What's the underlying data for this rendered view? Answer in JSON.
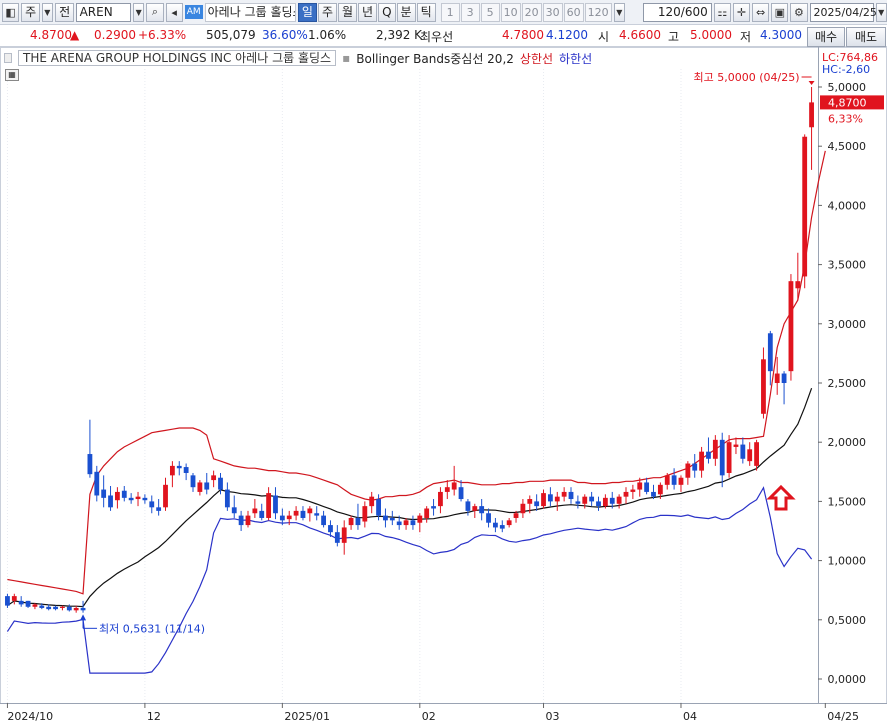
{
  "toolbar": {
    "market": "주",
    "all": "전",
    "symbol": "AREN",
    "am_badge": "AM",
    "name": "아레나 그룹 홀딩스",
    "periods": [
      "일",
      "주",
      "월",
      "년",
      "Q",
      "분",
      "틱"
    ],
    "selected_period": "일",
    "intervals": [
      "1",
      "3",
      "5",
      "10",
      "20",
      "30",
      "60",
      "120"
    ],
    "count": "120",
    "total": "/600",
    "date": "2025/04/25"
  },
  "quote": {
    "price": "4.8700",
    "change": "0.2900",
    "change_pct": "+6.33%",
    "volume": "505,079",
    "turnover_pct": "36.60%",
    "vol_ratio": "1.06%",
    "amount": "2,392 K",
    "best_ask_label": "최우선",
    "best_ask": "4.7800",
    "best_bid": "4.1200",
    "open_label": "시",
    "open": "4.6600",
    "high_label": "고",
    "high": "5.0000",
    "low_label": "저",
    "low": "4.3000",
    "buy_label": "매수",
    "sell_label": "매도"
  },
  "legend": {
    "company": "THE ARENA GROUP HOLDINGS INC  아레나 그룹 홀딩스",
    "indicator": "Bollinger Bands중심선 20,2",
    "upper": "상한선",
    "lower": "하한선"
  },
  "colors": {
    "up": "#e0141e",
    "down": "#1a50d0",
    "upper_band": "#d0161e",
    "lower_band": "#2a32c8",
    "middle_band": "#111111",
    "last_price_bg": "#e0141e"
  },
  "chart_data": {
    "type": "candlestick",
    "y_ticks": [
      "5,0000",
      "4,5000",
      "4,0000",
      "3,5000",
      "3,0000",
      "2,5000",
      "2,0000",
      "1,5000",
      "1,0000",
      "0,5000",
      "0,0000"
    ],
    "ylim": [
      0,
      5.0
    ],
    "x_ticks": [
      {
        "label": "2024/10",
        "idx": 0
      },
      {
        "label": "12",
        "idx": 20
      },
      {
        "label": "2025/01",
        "idx": 40
      },
      {
        "label": "02",
        "idx": 60
      },
      {
        "label": "03",
        "idx": 78
      },
      {
        "label": "04",
        "idx": 98
      },
      {
        "label": "04/25",
        "idx": 119
      }
    ],
    "lc": "LC:764,86",
    "hc": "HC:-2,60",
    "last_price": "4,8700",
    "last_pct": "6,33%",
    "high_note": "최고 5,0000 (04/25)",
    "low_note": "최저 0,5631 (11/14)",
    "candles": [
      [
        0.7,
        0.72,
        0.6,
        0.62
      ],
      [
        0.66,
        0.72,
        0.63,
        0.7
      ],
      [
        0.66,
        0.7,
        0.61,
        0.63
      ],
      [
        0.66,
        0.66,
        0.6,
        0.61
      ],
      [
        0.61,
        0.64,
        0.59,
        0.63
      ],
      [
        0.62,
        0.64,
        0.59,
        0.6
      ],
      [
        0.61,
        0.63,
        0.58,
        0.59
      ],
      [
        0.61,
        0.62,
        0.58,
        0.59
      ],
      [
        0.6,
        0.62,
        0.58,
        0.61
      ],
      [
        0.61,
        0.63,
        0.57,
        0.58
      ],
      [
        0.58,
        0.62,
        0.56,
        0.6
      ],
      [
        0.6,
        0.66,
        0.56,
        0.58
      ],
      [
        1.9,
        2.19,
        1.7,
        1.73
      ],
      [
        1.75,
        1.8,
        1.5,
        1.55
      ],
      [
        1.6,
        1.72,
        1.45,
        1.53
      ],
      [
        1.55,
        1.63,
        1.42,
        1.45
      ],
      [
        1.51,
        1.62,
        1.44,
        1.58
      ],
      [
        1.59,
        1.63,
        1.5,
        1.53
      ],
      [
        1.53,
        1.57,
        1.48,
        1.51
      ],
      [
        1.52,
        1.58,
        1.46,
        1.54
      ],
      [
        1.53,
        1.56,
        1.48,
        1.51
      ],
      [
        1.5,
        1.55,
        1.4,
        1.45
      ],
      [
        1.45,
        1.52,
        1.38,
        1.42
      ],
      [
        1.45,
        1.7,
        1.42,
        1.64
      ],
      [
        1.72,
        1.84,
        1.62,
        1.8
      ],
      [
        1.8,
        1.84,
        1.72,
        1.78
      ],
      [
        1.79,
        1.82,
        1.68,
        1.74
      ],
      [
        1.72,
        1.74,
        1.58,
        1.62
      ],
      [
        1.58,
        1.68,
        1.55,
        1.66
      ],
      [
        1.66,
        1.74,
        1.56,
        1.6
      ],
      [
        1.68,
        1.76,
        1.62,
        1.72
      ],
      [
        1.7,
        1.74,
        1.56,
        1.6
      ],
      [
        1.6,
        1.66,
        1.42,
        1.45
      ],
      [
        1.45,
        1.55,
        1.36,
        1.4
      ],
      [
        1.38,
        1.42,
        1.25,
        1.3
      ],
      [
        1.3,
        1.42,
        1.28,
        1.38
      ],
      [
        1.4,
        1.52,
        1.36,
        1.44
      ],
      [
        1.42,
        1.48,
        1.34,
        1.36
      ],
      [
        1.36,
        1.62,
        1.34,
        1.57
      ],
      [
        1.55,
        1.62,
        1.35,
        1.4
      ],
      [
        1.38,
        1.44,
        1.3,
        1.34
      ],
      [
        1.35,
        1.42,
        1.3,
        1.38
      ],
      [
        1.38,
        1.46,
        1.34,
        1.42
      ],
      [
        1.42,
        1.46,
        1.34,
        1.36
      ],
      [
        1.4,
        1.46,
        1.33,
        1.44
      ],
      [
        1.4,
        1.46,
        1.34,
        1.38
      ],
      [
        1.38,
        1.42,
        1.28,
        1.3
      ],
      [
        1.3,
        1.34,
        1.2,
        1.24
      ],
      [
        1.24,
        1.3,
        1.12,
        1.15
      ],
      [
        1.15,
        1.34,
        1.05,
        1.28
      ],
      [
        1.3,
        1.38,
        1.26,
        1.36
      ],
      [
        1.36,
        1.48,
        1.26,
        1.3
      ],
      [
        1.33,
        1.5,
        1.28,
        1.46
      ],
      [
        1.46,
        1.58,
        1.4,
        1.54
      ],
      [
        1.52,
        1.56,
        1.34,
        1.38
      ],
      [
        1.38,
        1.44,
        1.28,
        1.34
      ],
      [
        1.36,
        1.42,
        1.3,
        1.34
      ],
      [
        1.33,
        1.38,
        1.26,
        1.3
      ],
      [
        1.3,
        1.36,
        1.26,
        1.34
      ],
      [
        1.34,
        1.38,
        1.26,
        1.3
      ],
      [
        1.32,
        1.4,
        1.24,
        1.38
      ],
      [
        1.36,
        1.46,
        1.32,
        1.44
      ],
      [
        1.46,
        1.52,
        1.38,
        1.44
      ],
      [
        1.46,
        1.62,
        1.4,
        1.58
      ],
      [
        1.58,
        1.68,
        1.52,
        1.62
      ],
      [
        1.6,
        1.8,
        1.55,
        1.66
      ],
      [
        1.62,
        1.68,
        1.5,
        1.52
      ],
      [
        1.5,
        1.52,
        1.38,
        1.42
      ],
      [
        1.42,
        1.48,
        1.36,
        1.46
      ],
      [
        1.46,
        1.52,
        1.34,
        1.4
      ],
      [
        1.4,
        1.44,
        1.28,
        1.32
      ],
      [
        1.32,
        1.36,
        1.24,
        1.28
      ],
      [
        1.3,
        1.34,
        1.24,
        1.27
      ],
      [
        1.3,
        1.36,
        1.28,
        1.34
      ],
      [
        1.36,
        1.42,
        1.32,
        1.4
      ],
      [
        1.4,
        1.52,
        1.36,
        1.48
      ],
      [
        1.48,
        1.55,
        1.4,
        1.52
      ],
      [
        1.5,
        1.56,
        1.42,
        1.46
      ],
      [
        1.46,
        1.6,
        1.44,
        1.57
      ],
      [
        1.56,
        1.62,
        1.46,
        1.5
      ],
      [
        1.5,
        1.58,
        1.42,
        1.54
      ],
      [
        1.54,
        1.62,
        1.5,
        1.58
      ],
      [
        1.58,
        1.62,
        1.48,
        1.52
      ],
      [
        1.5,
        1.55,
        1.44,
        1.48
      ],
      [
        1.48,
        1.56,
        1.44,
        1.54
      ],
      [
        1.54,
        1.58,
        1.46,
        1.5
      ],
      [
        1.5,
        1.54,
        1.42,
        1.46
      ],
      [
        1.46,
        1.56,
        1.44,
        1.53
      ],
      [
        1.53,
        1.58,
        1.44,
        1.48
      ],
      [
        1.48,
        1.56,
        1.44,
        1.54
      ],
      [
        1.54,
        1.62,
        1.48,
        1.58
      ],
      [
        1.58,
        1.64,
        1.52,
        1.6
      ],
      [
        1.6,
        1.7,
        1.54,
        1.66
      ],
      [
        1.66,
        1.7,
        1.56,
        1.58
      ],
      [
        1.58,
        1.64,
        1.52,
        1.54
      ],
      [
        1.56,
        1.66,
        1.52,
        1.64
      ],
      [
        1.64,
        1.74,
        1.6,
        1.72
      ],
      [
        1.72,
        1.78,
        1.6,
        1.64
      ],
      [
        1.64,
        1.72,
        1.58,
        1.7
      ],
      [
        1.7,
        1.84,
        1.64,
        1.82
      ],
      [
        1.82,
        1.9,
        1.7,
        1.76
      ],
      [
        1.76,
        1.96,
        1.7,
        1.92
      ],
      [
        1.92,
        2.04,
        1.82,
        1.86
      ],
      [
        1.86,
        2.06,
        1.8,
        2.02
      ],
      [
        2.02,
        2.08,
        1.62,
        1.72
      ],
      [
        1.74,
        2.06,
        1.7,
        2.0
      ],
      [
        1.96,
        2.04,
        1.9,
        1.98
      ],
      [
        1.98,
        2.04,
        1.82,
        1.86
      ],
      [
        1.84,
        2.0,
        1.8,
        1.94
      ],
      [
        1.8,
        2.02,
        1.76,
        2.0
      ],
      [
        2.24,
        2.8,
        2.2,
        2.7
      ],
      [
        2.92,
        2.94,
        2.48,
        2.6
      ],
      [
        2.5,
        2.72,
        2.4,
        2.58
      ],
      [
        2.58,
        2.6,
        2.32,
        2.5
      ],
      [
        2.6,
        3.42,
        2.52,
        3.36
      ],
      [
        3.3,
        3.6,
        3.2,
        3.36
      ],
      [
        3.4,
        4.6,
        3.3,
        4.58
      ],
      [
        4.66,
        5.0,
        4.3,
        4.87
      ]
    ],
    "upper_band": [
      0.84,
      0.83,
      0.82,
      0.81,
      0.8,
      0.79,
      0.78,
      0.77,
      0.76,
      0.75,
      0.74,
      0.72,
      1.56,
      1.72,
      1.8,
      1.86,
      1.92,
      1.96,
      1.99,
      2.02,
      2.05,
      2.08,
      2.09,
      2.1,
      2.11,
      2.12,
      2.12,
      2.12,
      2.1,
      2.06,
      1.86,
      1.84,
      1.82,
      1.8,
      1.79,
      1.78,
      1.78,
      1.77,
      1.76,
      1.76,
      1.75,
      1.74,
      1.74,
      1.73,
      1.72,
      1.7,
      1.68,
      1.66,
      1.64,
      1.6,
      1.56,
      1.54,
      1.52,
      1.51,
      1.52,
      1.54,
      1.54,
      1.55,
      1.55,
      1.56,
      1.58,
      1.62,
      1.65,
      1.66,
      1.67,
      1.68,
      1.66,
      1.66,
      1.65,
      1.64,
      1.64,
      1.64,
      1.65,
      1.65,
      1.66,
      1.66,
      1.67,
      1.67,
      1.67,
      1.68,
      1.68,
      1.68,
      1.68,
      1.66,
      1.66,
      1.65,
      1.65,
      1.65,
      1.66,
      1.66,
      1.67,
      1.67,
      1.68,
      1.69,
      1.7,
      1.7,
      1.72,
      1.74,
      1.76,
      1.78,
      1.82,
      1.86,
      1.9,
      1.94,
      1.98,
      2.02,
      2.03,
      2.03,
      2.03,
      2.04,
      2.05,
      2.4,
      2.8,
      3.0,
      3.1,
      3.2,
      3.5,
      3.9,
      4.2,
      4.46
    ]
  }
}
